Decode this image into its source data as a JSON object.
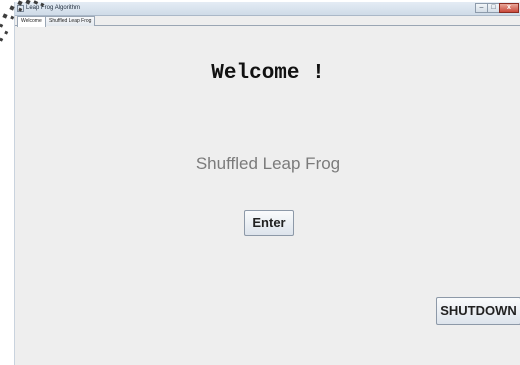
{
  "window": {
    "title": "Leap Frog Algorithm",
    "controls": {
      "minimize": "–",
      "maximize": "□",
      "close": "x"
    }
  },
  "tabs": [
    {
      "label": "Welcome",
      "active": true
    },
    {
      "label": "Shuffled Leap Frog",
      "active": false
    }
  ],
  "main": {
    "heading": "Welcome !",
    "subtitle": "Shuffled Leap Frog",
    "enter_label": "Enter",
    "shutdown_label": "SHUTDOWN"
  },
  "colors": {
    "background": "#eeeeee",
    "subtitle_text": "#7b7b7b",
    "close_button": "#c9483a"
  }
}
